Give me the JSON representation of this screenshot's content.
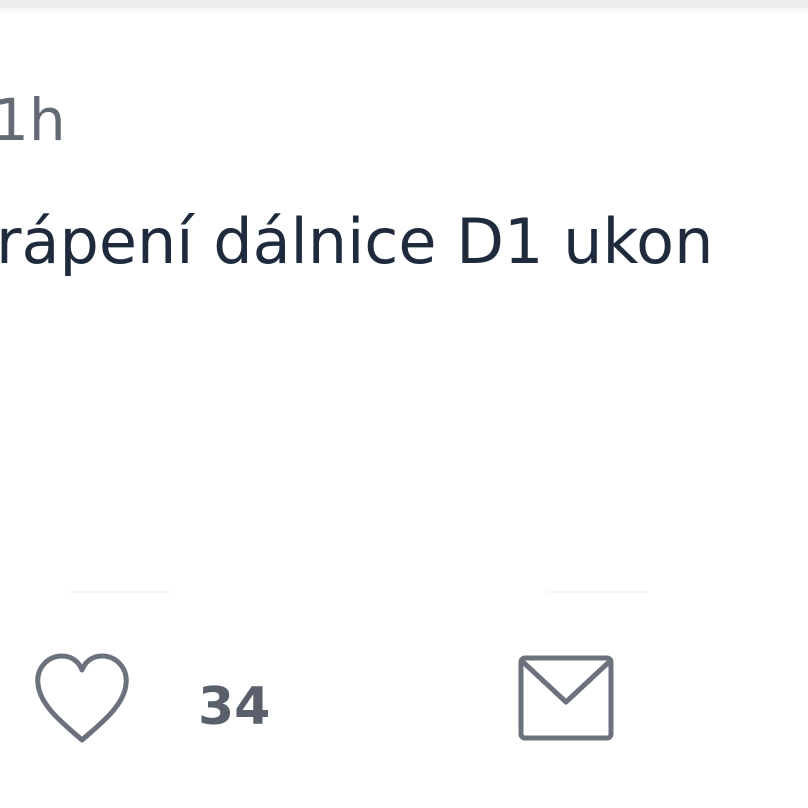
{
  "post": {
    "timestamp": "1h",
    "headline": "rápení dálnice D1 ukon"
  },
  "actions": {
    "like_icon": "heart-outline-icon",
    "like_count": "34",
    "message_icon": "envelope-icon"
  },
  "colors": {
    "text_primary": "#1f2a3d",
    "text_secondary": "#646a74",
    "icon": "#6c727c"
  }
}
